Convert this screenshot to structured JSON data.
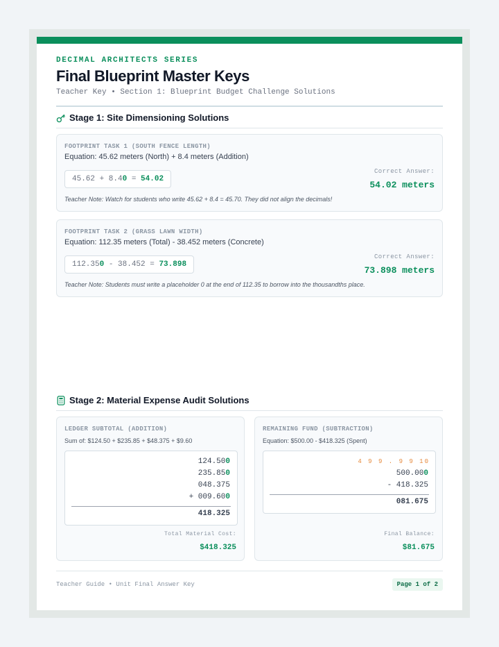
{
  "header": {
    "series": "DECIMAL ARCHITECTS SERIES",
    "title": "Final Blueprint Master Keys",
    "subtitle": "Teacher Key • Section 1: Blueprint Budget Challenge Solutions"
  },
  "stage1": {
    "icon": "key-icon",
    "title": "Stage 1: Site Dimensioning Solutions",
    "tasks": [
      {
        "label": "FOOTPRINT TASK 1 (SOUTH FENCE LENGTH)",
        "equation": "Equation: 45.62 meters (North) + 8.4 meters (Addition)",
        "expr_pre": "45.62 + 8.4",
        "expr_placeholder": "0",
        "expr_mid": " = ",
        "expr_result": "54.02",
        "answer_label": "Correct Answer:",
        "answer": "54.02 meters",
        "note": "Teacher Note: Watch for students who write 45.62 + 8.4 = 45.70. They did not align the decimals!"
      },
      {
        "label": "FOOTPRINT TASK 2 (GRASS LAWN WIDTH)",
        "equation": "Equation: 112.35 meters (Total) - 38.452 meters (Concrete)",
        "expr_pre": "112.35",
        "expr_placeholder": "0",
        "expr_mid": " - 38.452 = ",
        "expr_result": "73.898",
        "answer_label": "Correct Answer:",
        "answer": "73.898 meters",
        "note": "Teacher Note: Students must write a placeholder 0 at the end of 112.35 to borrow into the thousandths place."
      }
    ]
  },
  "stage2": {
    "icon": "calculator-icon",
    "title": "Stage 2: Material Expense Audit Solutions",
    "ledger": {
      "label": "LEDGER SUBTOTAL (ADDITION)",
      "sum": "Sum of: $124.50 + $235.85 + $48.375 + $9.60",
      "lines": [
        {
          "main": "124.50",
          "pad": "0"
        },
        {
          "main": "235.85",
          "pad": "0"
        },
        {
          "main": "048.375",
          "pad": ""
        },
        {
          "main": "+ 009.60",
          "pad": "0"
        }
      ],
      "result": "418.325",
      "total_label": "Total Material Cost:",
      "total": "$418.325"
    },
    "remaining": {
      "label": "REMAINING FUND (SUBTRACTION)",
      "equation": "Equation: $500.00 - $418.325 (Spent)",
      "borrow": "4 9 9 . 9 9 10",
      "line1_main": "500.00",
      "line1_pad": "0",
      "line2": "- 418.325",
      "result": "081.675",
      "balance_label": "Final Balance:",
      "balance": "$81.675"
    }
  },
  "footer": {
    "left": "Teacher Guide • Unit Final Answer Key",
    "page": "Page 1 of 2"
  },
  "colors": {
    "accent": "#0b8f5c",
    "borrow": "#e6883a"
  }
}
